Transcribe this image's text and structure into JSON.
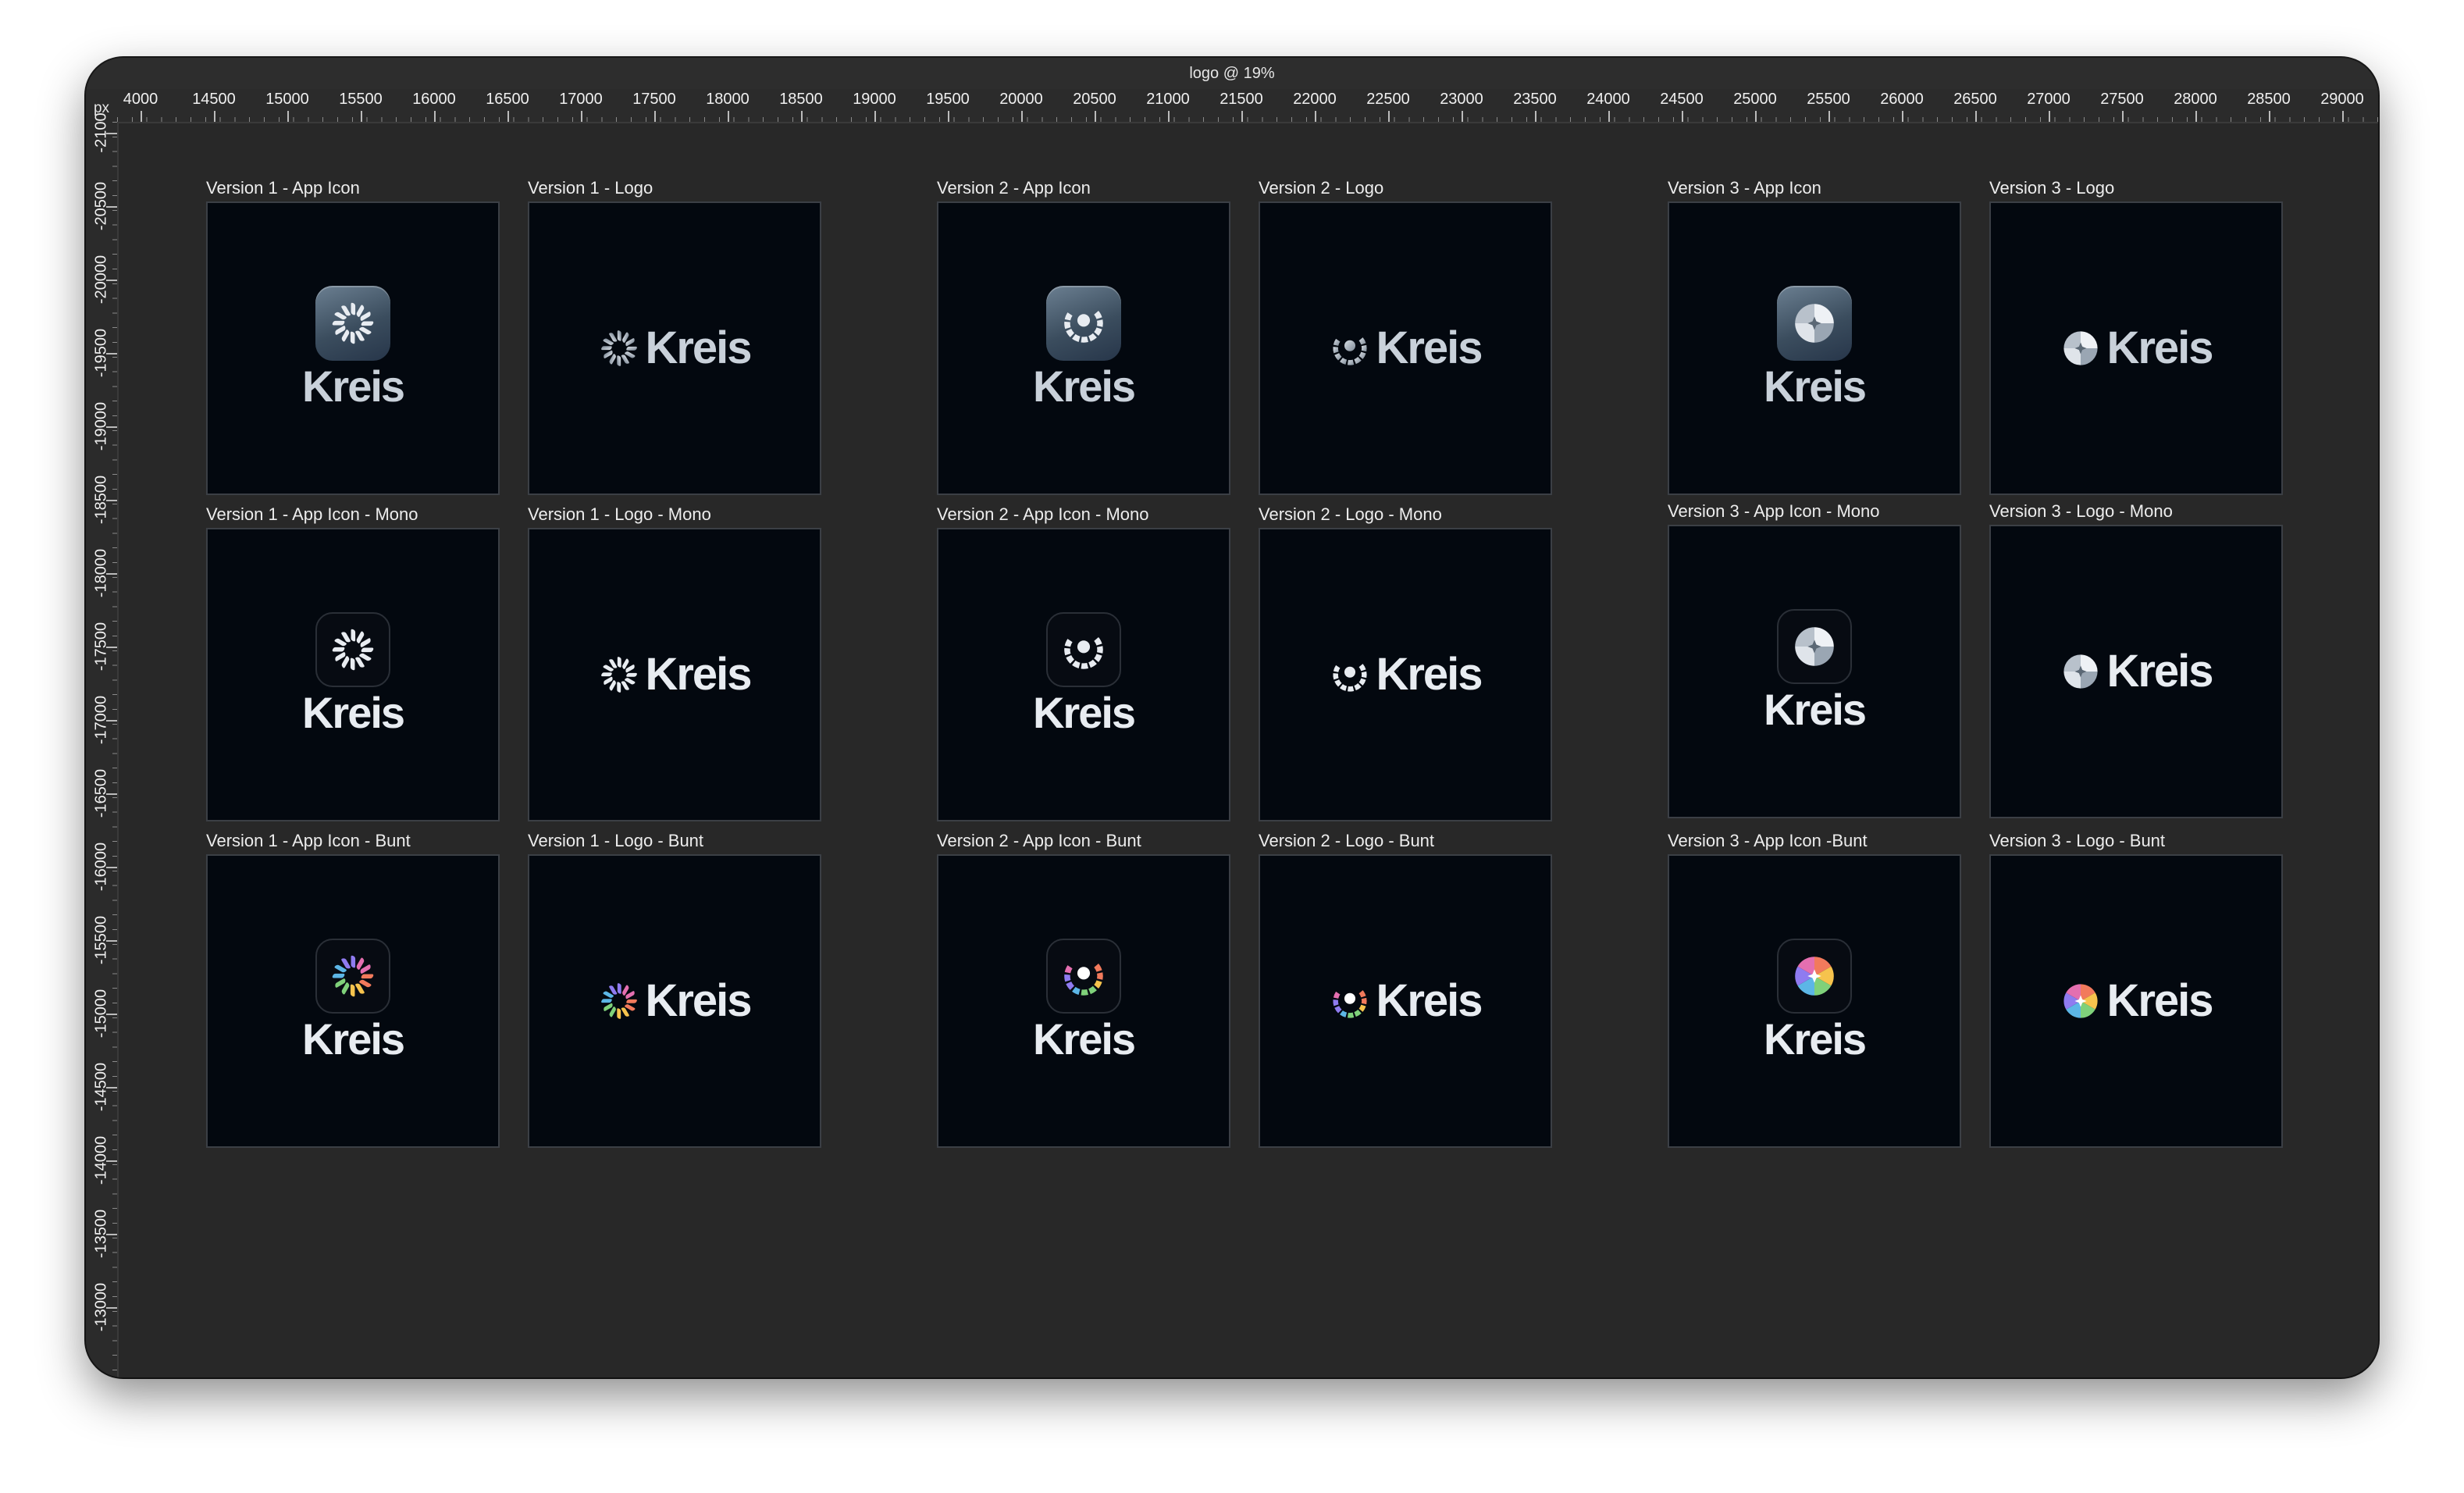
{
  "window": {
    "title": "logo @ 19%"
  },
  "ruler": {
    "unit": "px",
    "horizontal": [
      "4000",
      "14500",
      "15000",
      "15500",
      "16000",
      "16500",
      "17000",
      "17500",
      "18000",
      "18500",
      "19000",
      "19500",
      "20000",
      "20500",
      "21000",
      "21500",
      "22000",
      "22500",
      "23000",
      "23500",
      "24000",
      "24500",
      "25000",
      "25500",
      "26000",
      "26500",
      "27000",
      "27500",
      "28000",
      "28500",
      "29000"
    ],
    "vertical": [
      "-2100",
      "-20500",
      "-20000",
      "-19500",
      "-19000",
      "-18500",
      "-18000",
      "-17500",
      "-17000",
      "-16500",
      "-16000",
      "-15500",
      "-15000",
      "-14500",
      "-14000",
      "-13500",
      "-13000"
    ]
  },
  "wordmark": "Kreis",
  "artboards": [
    {
      "label": "Version 1 - App Icon",
      "version": 1,
      "kind": "app",
      "style": "grad",
      "icon": "sunburst-icon"
    },
    {
      "label": "Version 1 - Logo",
      "version": 1,
      "kind": "logo",
      "style": "grad",
      "icon": "sunburst-icon"
    },
    {
      "label": "Version 2 - App Icon",
      "version": 2,
      "kind": "app",
      "style": "grad",
      "icon": "eye-ring-icon"
    },
    {
      "label": "Version 2 - Logo",
      "version": 2,
      "kind": "logo",
      "style": "grad",
      "icon": "eye-ring-icon"
    },
    {
      "label": "Version 3 - App Icon",
      "version": 3,
      "kind": "app",
      "style": "grad",
      "icon": "quad-disc-icon"
    },
    {
      "label": "Version 3 - Logo",
      "version": 3,
      "kind": "logo",
      "style": "grad",
      "icon": "quad-disc-icon"
    },
    {
      "label": "Version 1 - App Icon - Mono",
      "version": 1,
      "kind": "app",
      "style": "mono",
      "icon": "sunburst-icon"
    },
    {
      "label": "Version 1 - Logo - Mono",
      "version": 1,
      "kind": "logo",
      "style": "mono",
      "icon": "sunburst-icon"
    },
    {
      "label": "Version 2 - App Icon - Mono",
      "version": 2,
      "kind": "app",
      "style": "mono",
      "icon": "eye-ring-icon"
    },
    {
      "label": "Version 2 - Logo - Mono",
      "version": 2,
      "kind": "logo",
      "style": "mono",
      "icon": "eye-ring-icon"
    },
    {
      "label": "Version 3 - App Icon - Mono",
      "version": 3,
      "kind": "app",
      "style": "mono",
      "icon": "quad-disc-icon"
    },
    {
      "label": "Version 3 - Logo - Mono",
      "version": 3,
      "kind": "logo",
      "style": "mono",
      "icon": "quad-disc-icon"
    },
    {
      "label": "Version 1 - App Icon - Bunt",
      "version": 1,
      "kind": "app",
      "style": "bunt",
      "icon": "sunburst-icon"
    },
    {
      "label": "Version 1 - Logo - Bunt",
      "version": 1,
      "kind": "logo",
      "style": "bunt",
      "icon": "sunburst-icon"
    },
    {
      "label": "Version 2 - App Icon - Bunt",
      "version": 2,
      "kind": "app",
      "style": "bunt",
      "icon": "eye-ring-icon"
    },
    {
      "label": "Version 2 - Logo - Bunt",
      "version": 2,
      "kind": "logo",
      "style": "bunt",
      "icon": "eye-ring-icon"
    },
    {
      "label": "Version 3 - App Icon -Bunt",
      "version": 3,
      "kind": "app",
      "style": "bunt",
      "icon": "quad-disc-icon"
    },
    {
      "label": "Version 3 - Logo - Bunt",
      "version": 3,
      "kind": "logo",
      "style": "bunt",
      "icon": "quad-disc-icon"
    }
  ],
  "colors": {
    "canvas": "#282828",
    "artboard": "#03080f",
    "mono": "#e8ecf1",
    "grad_light": "#d7dde4",
    "grad_dark": "#7e8a97",
    "bunt": [
      "#f27a5c",
      "#f6c34d",
      "#7fd17a",
      "#5cb6e6",
      "#8f7bf0",
      "#e46fb0"
    ]
  }
}
